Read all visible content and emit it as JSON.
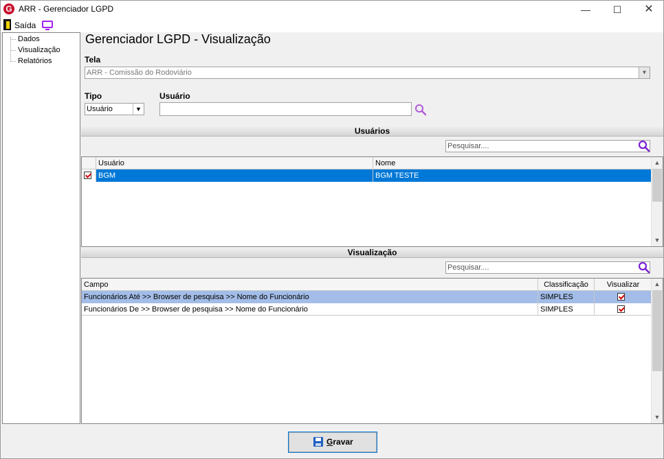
{
  "window": {
    "title": "ARR - Gerenciador LGPD",
    "logo_letter": "G",
    "minimize": "—",
    "maximize": "☐",
    "close": "✕"
  },
  "menu": {
    "exit_label": "Saída"
  },
  "tree": {
    "items": [
      {
        "label": "Dados"
      },
      {
        "label": "Visualização"
      },
      {
        "label": "Relatórios"
      }
    ]
  },
  "main": {
    "title": "Gerenciador LGPD - Visualização",
    "tela_label": "Tela",
    "tela_value": "ARR - Comissão do Rodoviário",
    "tipo_label": "Tipo",
    "tipo_value": "Usuário",
    "usuario_label": "Usuário",
    "usuario_value": ""
  },
  "users_section": {
    "title": "Usuários",
    "search_placeholder": "Pesquisar....",
    "columns": [
      "Usuário",
      "Nome"
    ],
    "rows": [
      {
        "checked": true,
        "usuario": "BGM",
        "nome": "BGM TESTE"
      }
    ]
  },
  "view_section": {
    "title": "Visualização",
    "search_placeholder": "Pesquisar....",
    "columns": [
      "Campo",
      "Classificação",
      "Visualizar"
    ],
    "rows": [
      {
        "campo": "Funcionários Até >> Browser de pesquisa >> Nome do Funcionário",
        "classificacao": "SIMPLES",
        "visualizar": true
      },
      {
        "campo": "Funcionários De >> Browser de pesquisa >> Nome do Funcionário",
        "classificacao": "SIMPLES",
        "visualizar": true
      }
    ]
  },
  "footer": {
    "save_first": "G",
    "save_rest": "ravar"
  },
  "colors": {
    "selection_blue": "#0078d7",
    "selection_light": "#a3bde8",
    "accent_purple": "#a020f0"
  }
}
